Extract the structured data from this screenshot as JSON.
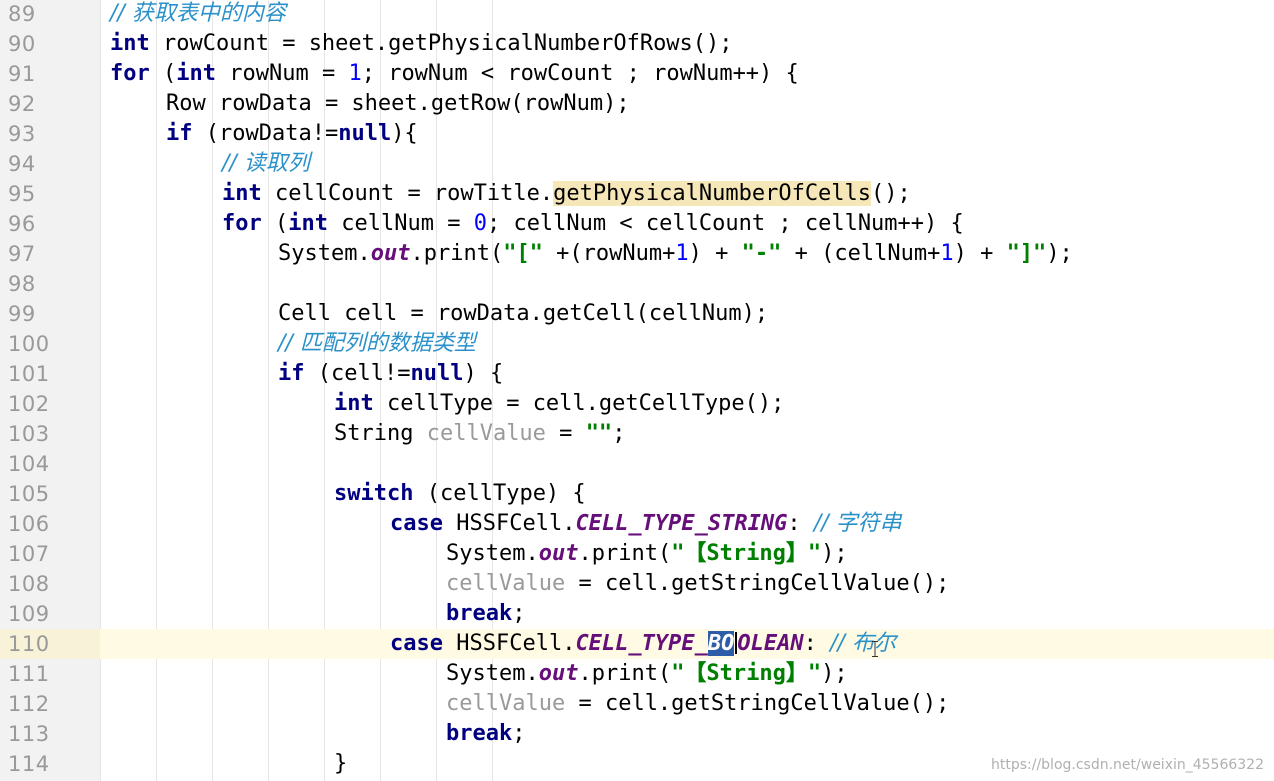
{
  "editor": {
    "current_line": "110",
    "lines": [
      {
        "num": "89",
        "indent": 2,
        "t": [
          {
            "c": "cm",
            "v": "// 获取表中的内容"
          }
        ]
      },
      {
        "num": "90",
        "indent": 2,
        "t": [
          {
            "c": "kw",
            "v": "int"
          },
          {
            "v": " rowCount = sheet.getPhysicalNumberOfRows();"
          }
        ]
      },
      {
        "num": "91",
        "indent": 2,
        "t": [
          {
            "c": "kw",
            "v": "for"
          },
          {
            "v": " ("
          },
          {
            "c": "kw",
            "v": "int"
          },
          {
            "v": " rowNum = "
          },
          {
            "c": "nm",
            "v": "1"
          },
          {
            "v": "; rowNum < rowCount ; rowNum++) {"
          }
        ]
      },
      {
        "num": "92",
        "indent": 3,
        "t": [
          {
            "v": "Row rowData = sheet.getRow(rowNum);"
          }
        ]
      },
      {
        "num": "93",
        "indent": 3,
        "t": [
          {
            "c": "kw",
            "v": "if"
          },
          {
            "v": " (rowData!="
          },
          {
            "c": "kw",
            "v": "null"
          },
          {
            "v": "){"
          }
        ]
      },
      {
        "num": "94",
        "indent": 4,
        "t": [
          {
            "c": "cm",
            "v": "// 读取列"
          }
        ]
      },
      {
        "num": "95",
        "indent": 4,
        "t": [
          {
            "c": "kw",
            "v": "int"
          },
          {
            "v": " cellCount = rowTitle."
          },
          {
            "c": "hl",
            "v": "getPhysicalNumberOfCells"
          },
          {
            "v": "();"
          }
        ]
      },
      {
        "num": "96",
        "indent": 4,
        "t": [
          {
            "c": "kw",
            "v": "for"
          },
          {
            "v": " ("
          },
          {
            "c": "kw",
            "v": "int"
          },
          {
            "v": " cellNum = "
          },
          {
            "c": "nm",
            "v": "0"
          },
          {
            "v": "; cellNum < cellCount ; cellNum++) {"
          }
        ]
      },
      {
        "num": "97",
        "indent": 5,
        "t": [
          {
            "v": "System."
          },
          {
            "c": "sf",
            "v": "out"
          },
          {
            "v": ".print("
          },
          {
            "c": "st",
            "v": "\"[\""
          },
          {
            "v": " +(rowNum+"
          },
          {
            "c": "nm",
            "v": "1"
          },
          {
            "v": ") + "
          },
          {
            "c": "st",
            "v": "\"-\""
          },
          {
            "v": " + (cellNum+"
          },
          {
            "c": "nm",
            "v": "1"
          },
          {
            "v": ") + "
          },
          {
            "c": "st",
            "v": "\"]\""
          },
          {
            "v": ");"
          }
        ]
      },
      {
        "num": "98",
        "indent": 5,
        "t": []
      },
      {
        "num": "99",
        "indent": 5,
        "t": [
          {
            "v": "Cell cell = rowData.getCell(cellNum);"
          }
        ]
      },
      {
        "num": "100",
        "indent": 5,
        "t": [
          {
            "c": "cm",
            "v": "// 匹配列的数据类型"
          }
        ]
      },
      {
        "num": "101",
        "indent": 5,
        "t": [
          {
            "c": "kw",
            "v": "if"
          },
          {
            "v": " (cell!="
          },
          {
            "c": "kw",
            "v": "null"
          },
          {
            "v": ") {"
          }
        ]
      },
      {
        "num": "102",
        "indent": 6,
        "t": [
          {
            "c": "kw",
            "v": "int"
          },
          {
            "v": " cellType = cell.getCellType();"
          }
        ]
      },
      {
        "num": "103",
        "indent": 6,
        "t": [
          {
            "v": "String "
          },
          {
            "c": "un",
            "v": "cellValue"
          },
          {
            "v": " = "
          },
          {
            "c": "st",
            "v": "\"\""
          },
          {
            "v": ";"
          }
        ]
      },
      {
        "num": "104",
        "indent": 6,
        "t": []
      },
      {
        "num": "105",
        "indent": 6,
        "t": [
          {
            "c": "kw",
            "v": "switch"
          },
          {
            "v": " (cellType) {"
          }
        ]
      },
      {
        "num": "106",
        "indent": 7,
        "t": [
          {
            "c": "kw",
            "v": "case"
          },
          {
            "v": " HSSFCell."
          },
          {
            "c": "fi",
            "v": "CELL_TYPE_STRING"
          },
          {
            "v": ": "
          },
          {
            "c": "cm",
            "v": "// 字符串"
          }
        ]
      },
      {
        "num": "107",
        "indent": 8,
        "t": [
          {
            "v": "System."
          },
          {
            "c": "sf",
            "v": "out"
          },
          {
            "v": ".print("
          },
          {
            "c": "st",
            "v": "\"【String】\""
          },
          {
            "v": ");"
          }
        ]
      },
      {
        "num": "108",
        "indent": 8,
        "t": [
          {
            "c": "un",
            "v": "cellValue"
          },
          {
            "v": " = cell.getStringCellValue();"
          }
        ]
      },
      {
        "num": "109",
        "indent": 8,
        "t": [
          {
            "c": "kw",
            "v": "break"
          },
          {
            "v": ";"
          }
        ]
      },
      {
        "num": "110",
        "indent": 7,
        "t": [
          {
            "c": "kw",
            "v": "case"
          },
          {
            "v": " HSSFCell."
          },
          {
            "c": "fi",
            "v": "CELL_TYPE_"
          },
          {
            "c": "fi sel",
            "v": "BO"
          },
          {
            "c": "caret",
            "v": ""
          },
          {
            "c": "fi",
            "v": "OLEAN"
          },
          {
            "v": ": "
          },
          {
            "c": "cm",
            "v": "// 布尔"
          }
        ]
      },
      {
        "num": "111",
        "indent": 8,
        "t": [
          {
            "v": "System."
          },
          {
            "c": "sf",
            "v": "out"
          },
          {
            "v": ".print("
          },
          {
            "c": "st",
            "v": "\"【String】\""
          },
          {
            "v": ");"
          }
        ]
      },
      {
        "num": "112",
        "indent": 8,
        "t": [
          {
            "c": "un",
            "v": "cellValue"
          },
          {
            "v": " = cell.getStringCellValue();"
          }
        ]
      },
      {
        "num": "113",
        "indent": 8,
        "t": [
          {
            "c": "kw",
            "v": "break"
          },
          {
            "v": ";"
          }
        ]
      },
      {
        "num": "114",
        "indent": 6,
        "t": [
          {
            "v": "}"
          }
        ]
      }
    ]
  },
  "watermark": "https://blog.csdn.net/weixin_45566322",
  "colors": {
    "keyword": "#000080",
    "comment": "#2b91c9",
    "number": "#0000ff",
    "string": "#008000",
    "static_field": "#660e7a",
    "unused": "#9a9a9a",
    "current_line_bg": "#fffae3",
    "selection": "#2d5ca8"
  }
}
